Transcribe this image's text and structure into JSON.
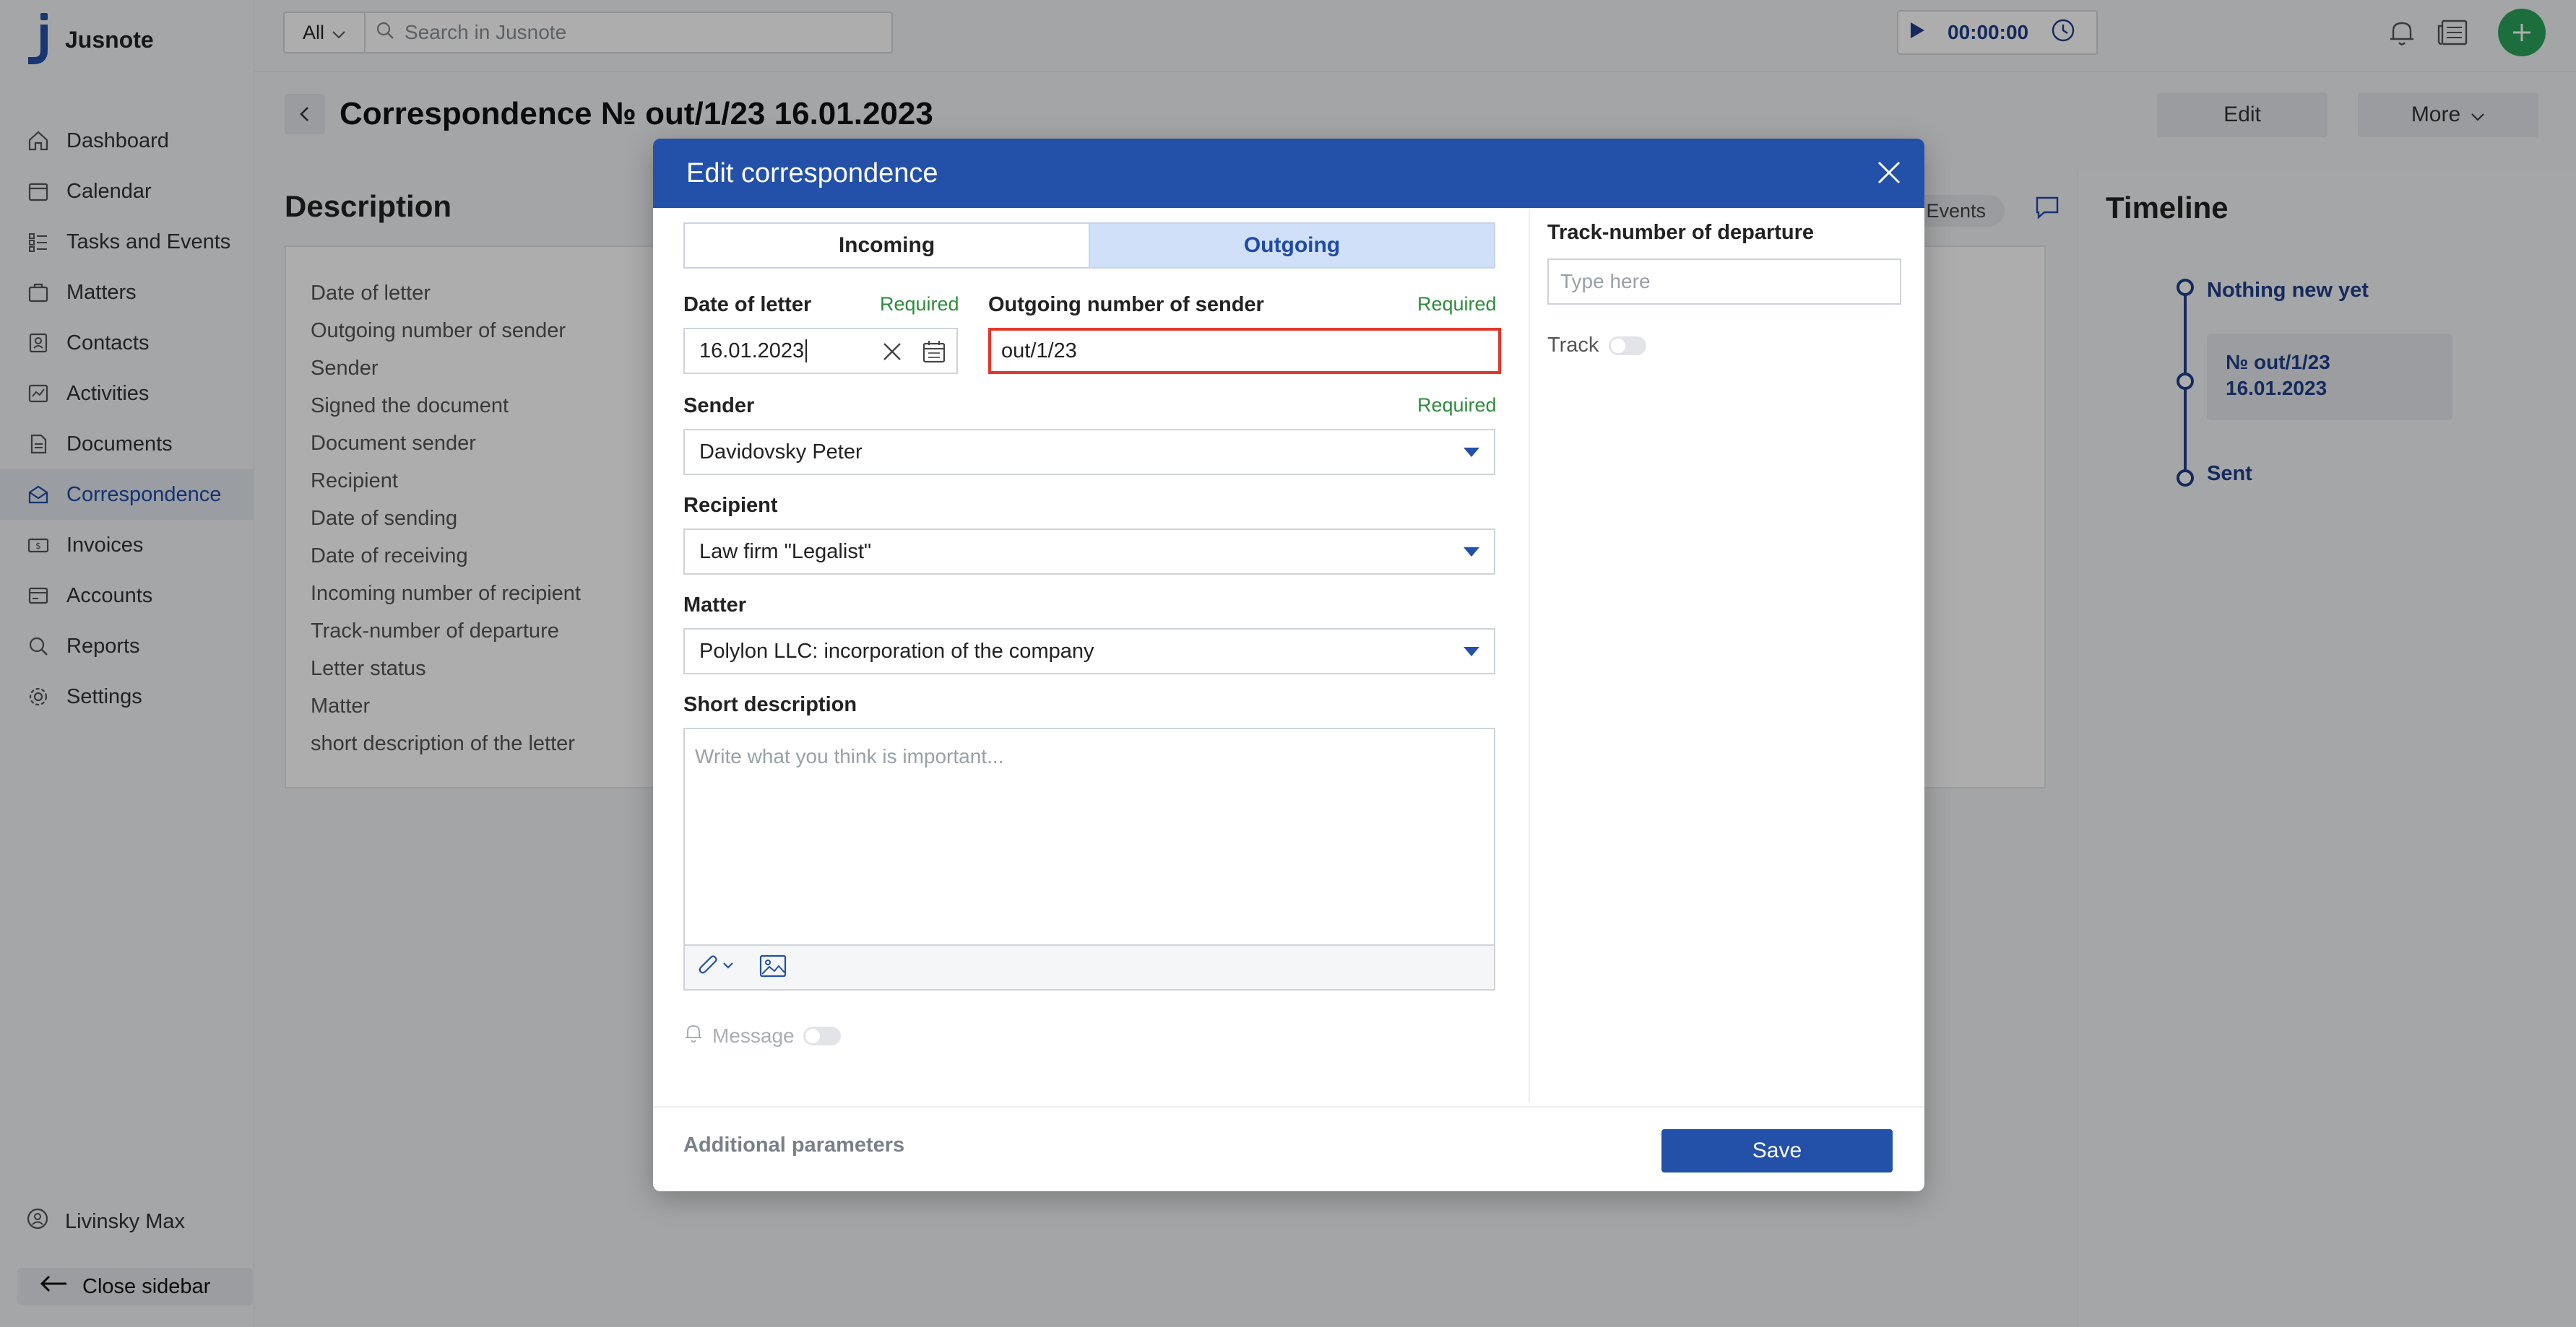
{
  "app": {
    "name": "Jusnote"
  },
  "sidebar": {
    "items": [
      {
        "label": "Dashboard",
        "icon": "home-icon"
      },
      {
        "label": "Calendar",
        "icon": "calendar-icon"
      },
      {
        "label": "Tasks and Events",
        "icon": "tasks-icon"
      },
      {
        "label": "Matters",
        "icon": "briefcase-icon"
      },
      {
        "label": "Contacts",
        "icon": "contacts-icon"
      },
      {
        "label": "Activities",
        "icon": "activities-icon"
      },
      {
        "label": "Documents",
        "icon": "document-icon"
      },
      {
        "label": "Correspondence",
        "icon": "correspondence-icon",
        "active": true
      },
      {
        "label": "Invoices",
        "icon": "invoice-icon"
      },
      {
        "label": "Accounts",
        "icon": "accounts-icon"
      },
      {
        "label": "Reports",
        "icon": "reports-icon"
      },
      {
        "label": "Settings",
        "icon": "gear-icon"
      }
    ],
    "user_name": "Livinsky Max",
    "close_label": "Close sidebar"
  },
  "topbar": {
    "search_scope": "All",
    "search_placeholder": "Search in Jusnote",
    "timer": "00:00:00"
  },
  "page": {
    "title": "Correspondence № out/1/23 16.01.2023",
    "edit_label": "Edit",
    "more_label": "More",
    "events_chip": "d Events"
  },
  "description": {
    "title": "Description",
    "labels": [
      "Date of letter",
      "Outgoing number of sender",
      "Sender",
      "Signed the document",
      "Document sender",
      "Recipient",
      "Date of sending",
      "Date of receiving",
      "Incoming number of recipient",
      "Track-number of departure",
      "Letter status",
      "Matter",
      "short description of the letter"
    ]
  },
  "timeline": {
    "title": "Timeline",
    "nothing_new": "Nothing new yet",
    "card_line1": "№ out/1/23",
    "card_line2": "16.01.2023",
    "sent": "Sent"
  },
  "modal": {
    "title": "Edit correspondence",
    "tabs": {
      "incoming": "Incoming",
      "outgoing": "Outgoing",
      "selected": "outgoing"
    },
    "required_label": "Required",
    "date_label": "Date of letter",
    "date_value": "16.01.2023",
    "outgoing_label": "Outgoing number of sender",
    "outgoing_value": "out/1/23",
    "sender_label": "Sender",
    "sender_value": "Davidovsky Peter",
    "recipient_label": "Recipient",
    "recipient_value": "Law firm \"Legalist\"",
    "matter_label": "Matter",
    "matter_value": "Polylon LLC: incorporation of the company",
    "short_label": "Short description",
    "short_placeholder": "Write what you think is important...",
    "message_label": "Message",
    "track_label": "Track-number of departure",
    "track_placeholder": "Type here",
    "track_toggle_label": "Track",
    "additional_label": "Additional parameters",
    "save_label": "Save"
  },
  "colors": {
    "brand": "#2350a8",
    "required": "#2e8b3e",
    "error": "#e0392b",
    "add": "#2aa35b"
  }
}
